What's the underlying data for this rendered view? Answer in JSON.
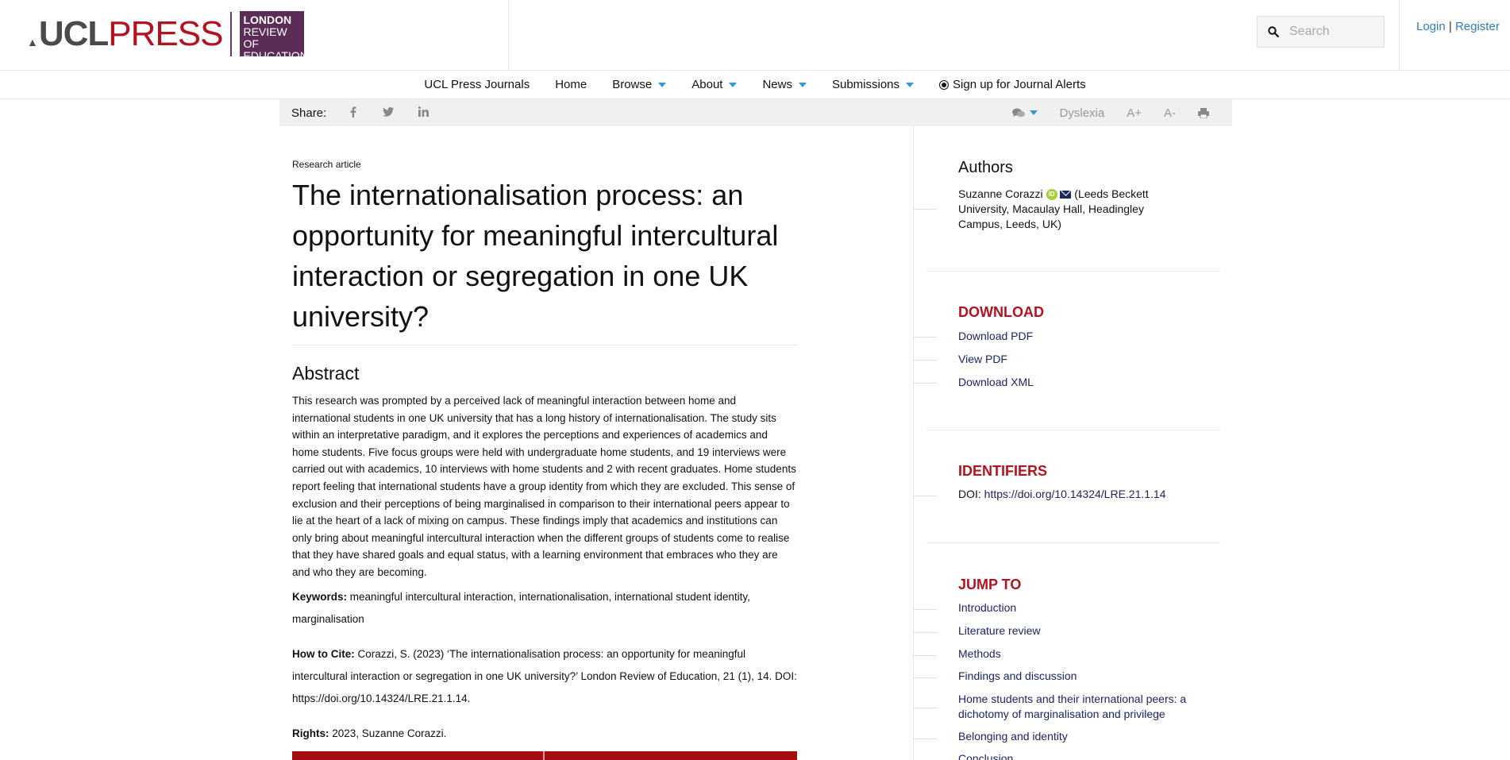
{
  "header": {
    "logo_ucl": "UCL",
    "logo_press": "PRESS",
    "logo_box_line1": "LONDON",
    "logo_box_line2": "REVIEW OF",
    "logo_box_line3": "EDUCATION",
    "search_placeholder": "Search",
    "login": "Login",
    "separator": "|",
    "register": "Register"
  },
  "nav": {
    "items": [
      {
        "label": "UCL Press Journals",
        "dropdown": false
      },
      {
        "label": "Home",
        "dropdown": false
      },
      {
        "label": "Browse",
        "dropdown": true
      },
      {
        "label": "About",
        "dropdown": true
      },
      {
        "label": "News",
        "dropdown": true
      },
      {
        "label": "Submissions",
        "dropdown": true
      }
    ],
    "alerts": "Sign up for Journal Alerts",
    "caret_color": "#2f9ad9"
  },
  "sharebar": {
    "label": "Share:",
    "icons": [
      "facebook-icon",
      "twitter-icon",
      "linkedin-icon"
    ],
    "dyslexia": "Dyslexia",
    "font_up": "A+",
    "font_down": "A-"
  },
  "article": {
    "type": "Research article",
    "title": "The internationalisation process: an opportunity for meaningful intercultural interaction or segregation in one UK university?",
    "abstract_heading": "Abstract",
    "abstract": "This research was prompted by a perceived lack of meaningful interaction between home and international students in one UK university that has a long history of internationalisation. The study sits within an interpretative paradigm, and it explores the perceptions and experiences of academics and home students. Five focus groups were held with undergraduate home students, and 19 interviews were carried out with academics, 10 interviews with home students and 2 with recent graduates. Home students report feeling that international students have a group identity from which they are excluded. This sense of exclusion and their perceptions of being marginalised in comparison to their international peers appear to lie at the heart of a lack of mixing on campus. These findings imply that academics and institutions can only bring about meaningful intercultural interaction when the different groups of students come to realise that they have shared goals and equal status, with a learning environment that embraces who they are and who they are becoming.",
    "keywords_label": "Keywords:",
    "keywords": "meaningful intercultural interaction, internationalisation, international student identity, marginalisation",
    "cite_label": "How to Cite:",
    "cite": "Corazzi, S. (2023) ‘The internationalisation process: an opportunity for meaningful intercultural interaction or segregation in one UK university?’ London Review of Education, 21 (1), 14. DOI: https://doi.org/10.14324/LRE.21.1.14.",
    "rights_label": "Rights:",
    "rights": "2023, Suzanne Corazzi."
  },
  "sidebar": {
    "authors_heading": "Authors",
    "author_name": "Suzanne Corazzi",
    "orcid_badge": "iD",
    "author_affiliation": "(Leeds Beckett University, Macaulay Hall, Headingley Campus, Leeds, UK)",
    "download_heading": "DOWNLOAD",
    "download_links": [
      "Download PDF",
      "View PDF",
      "Download XML"
    ],
    "identifiers_heading": "IDENTIFIERS",
    "doi_label": "DOI:",
    "doi_value": "https://doi.org/10.14324/LRE.21.1.14",
    "jump_heading": "JUMP TO",
    "jump_links": [
      "Introduction",
      "Literature review",
      "Methods",
      "Findings and discussion",
      "Home students and their international peers: a dichotomy of marginalisation and privilege",
      "Belonging and identity",
      "Conclusion"
    ]
  },
  "colors": {
    "brand_red": "#b3121f",
    "brand_purple": "#5b2c55",
    "link_blue": "#2f7fb6",
    "sidebar_link": "#1d2366"
  }
}
